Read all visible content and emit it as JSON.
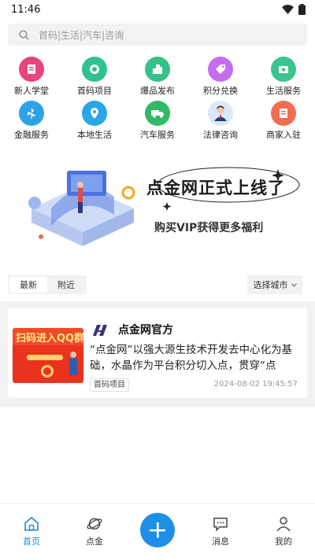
{
  "status": {
    "time": "11:46"
  },
  "search": {
    "placeholder": "首码|生活|汽车|咨询"
  },
  "categories": [
    {
      "label": "新人学堂",
      "icon": "book-icon",
      "color": "#e8457a"
    },
    {
      "label": "首码项目",
      "icon": "project-icon",
      "color": "#2ec28f"
    },
    {
      "label": "爆品发布",
      "icon": "building-icon",
      "color": "#35c18a"
    },
    {
      "label": "积分兑换",
      "icon": "tag-icon",
      "color": "#c56df0"
    },
    {
      "label": "生活服务",
      "icon": "life-service-icon",
      "color": "#39c58e"
    },
    {
      "label": "金融服务",
      "icon": "windmill-icon",
      "color": "#2fa2e6"
    },
    {
      "label": "本地生活",
      "icon": "location-icon",
      "color": "#2aa6e8"
    },
    {
      "label": "汽车服务",
      "icon": "truck-icon",
      "color": "#33b866"
    },
    {
      "label": "法律咨询",
      "icon": "lawyer-icon",
      "color": "#1f6fd0"
    },
    {
      "label": "商家入驻",
      "icon": "store-icon",
      "color": "#f26c4f"
    }
  ],
  "banner": {
    "title": "点金网正式上线了",
    "subtitle": "购买VIP获得更多福利"
  },
  "tabs": [
    {
      "label": "最新",
      "active": true
    },
    {
      "label": "附近",
      "active": false
    }
  ],
  "city_select": {
    "label": "选择城市"
  },
  "post": {
    "author": "点金网官方",
    "thumb_text": "扫码进入QQ群",
    "content": "“点金网”以强大源生技术开发去中心化为基础，水晶作为平台积分切入点，贯穿“点",
    "tag": "首码项目",
    "time": "2024-08-02 19:45:57"
  },
  "nav": [
    {
      "label": "首页",
      "active": true
    },
    {
      "label": "点金",
      "active": false
    },
    {
      "label": "消息",
      "active": false
    },
    {
      "label": "我的",
      "active": false
    }
  ],
  "colors": {
    "accent": "#1e8fe6",
    "background_gray": "#f2f2f4"
  }
}
